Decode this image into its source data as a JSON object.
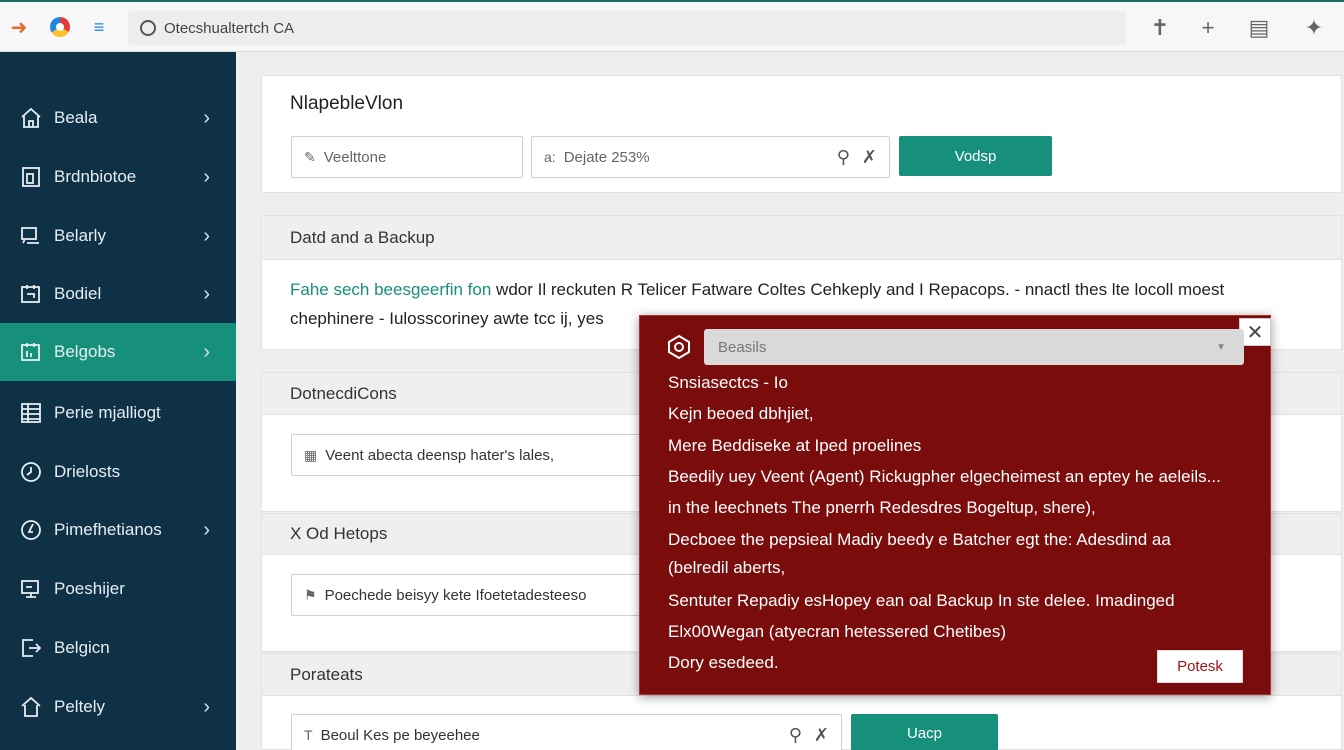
{
  "browser": {
    "address": "Otecshualtertch CA"
  },
  "sidebar": {
    "items": [
      {
        "label": "Beala",
        "icon": "home-icon",
        "chevron": true
      },
      {
        "label": "Brdnbiotoe",
        "icon": "document-icon",
        "chevron": true
      },
      {
        "label": "Belarly",
        "icon": "monitor-icon",
        "chevron": true
      },
      {
        "label": "Bodiel",
        "icon": "folder-icon",
        "chevron": true
      },
      {
        "label": "Belgobs",
        "icon": "window-icon",
        "chevron": true
      },
      {
        "label": "Perie mjalliogt",
        "icon": "list-icon",
        "chevron": false
      },
      {
        "label": "Drielosts",
        "icon": "clock-icon",
        "chevron": false
      },
      {
        "label": "Pimefhetianos",
        "icon": "target-icon",
        "chevron": true
      },
      {
        "label": "Poeshijer",
        "icon": "screen-icon",
        "chevron": false
      },
      {
        "label": "Belgicn",
        "icon": "export-icon",
        "chevron": false
      },
      {
        "label": "Peltely",
        "icon": "house-icon",
        "chevron": true
      }
    ],
    "active_index": 4
  },
  "header_panel": {
    "title": "NlapebleVlon",
    "input1_placeholder": "Veelttone",
    "input2_value": "Dejate 253%",
    "input2_prefix": "a:",
    "button_label": "Vodsp"
  },
  "section1": {
    "title": "Datd and a Backup",
    "link_text": "Fahe sech beesgeerfin fon",
    "line1": "wdor Il reckuten R Telicer Fatware Coltes Cehkeply and I Repacops. - nnactl thes lte locoll moest",
    "line2": "chephinere - Iulosscoriney awte tcc ij, yes"
  },
  "section2": {
    "title": "DotnecdiCons",
    "input_value": "Veent abecta deensp hater's lales,"
  },
  "section3": {
    "title": "X Od Hetops",
    "input_value": "Poechede beisyy kete Ifoetetadesteeso"
  },
  "section4": {
    "title": "Porateats",
    "input_value": "Beoul Kes pe beyeehee",
    "button_label": "Uacp"
  },
  "modal": {
    "search_placeholder": "Beasils",
    "lines": [
      "Snsiasectcs - Io",
      "Kejn beoed dbhjiet,",
      "Mere Beddiseke at Iped proelines",
      "Beedily uey Veent (Agent) Rickugpher elgecheimest an eptey he aeleils...",
      "in the leechnets The pnerrh Redesdres Bogeltup, shere),",
      "Decboee the pepsieal Madiy beedy e Batcher egt the: Adesdind aa",
      "(belredil aberts,",
      "Sentuter Repadiy esHopey ean oal Backup In ste delee. Imadinged",
      "Elx00Wegan (atyecran hetessered Chetibes)",
      "Dory esedeed."
    ],
    "button_label": "Potesk"
  }
}
